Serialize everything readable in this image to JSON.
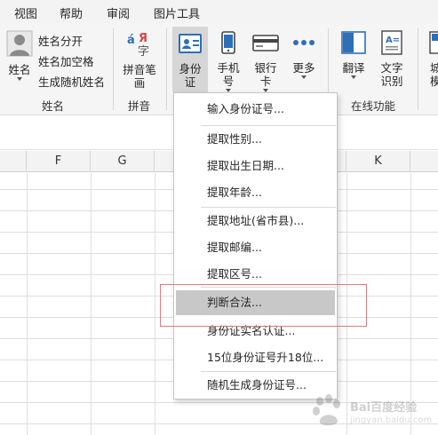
{
  "menu_tabs": [
    "视图",
    "帮助",
    "审阅",
    "图片工具"
  ],
  "ribbon": {
    "name_group": {
      "big_label_line1": "姓名",
      "items": [
        "姓名分开",
        "姓名加空格",
        "生成随机姓名"
      ],
      "group_label": "姓名"
    },
    "pinyin_group": {
      "button_label": "拼音笔\n画",
      "group_label": "拼音"
    },
    "id_buttons": [
      {
        "label": "身份\n证"
      },
      {
        "label": "手机\n号"
      },
      {
        "label": "银行\n卡"
      },
      {
        "label": "更多"
      }
    ],
    "online_group": {
      "translate_label": "翻译",
      "ocr_label": "文字\n识别",
      "group_label": "在线功能"
    },
    "partial_right_label": "城\n模"
  },
  "columns": [
    "F",
    "G",
    "K"
  ],
  "dropdown": {
    "items": [
      "输入身份证号...",
      "提取性别...",
      "提取出生日期...",
      "提取年龄...",
      "提取地址(省市县)...",
      "提取邮编...",
      "提取区号...",
      "判断合法...",
      "身份证实名认证...",
      "15位身份证号升18位...",
      "随机生成身份证号..."
    ],
    "highlighted_index": 7
  },
  "watermark": {
    "text": "Bai百度经验",
    "url": "jingyan.baidu.com"
  },
  "colors": {
    "accent_blue": "#2e6fb8",
    "highlight_gray": "#c8c8c8",
    "red_box": "#e07a7a"
  }
}
